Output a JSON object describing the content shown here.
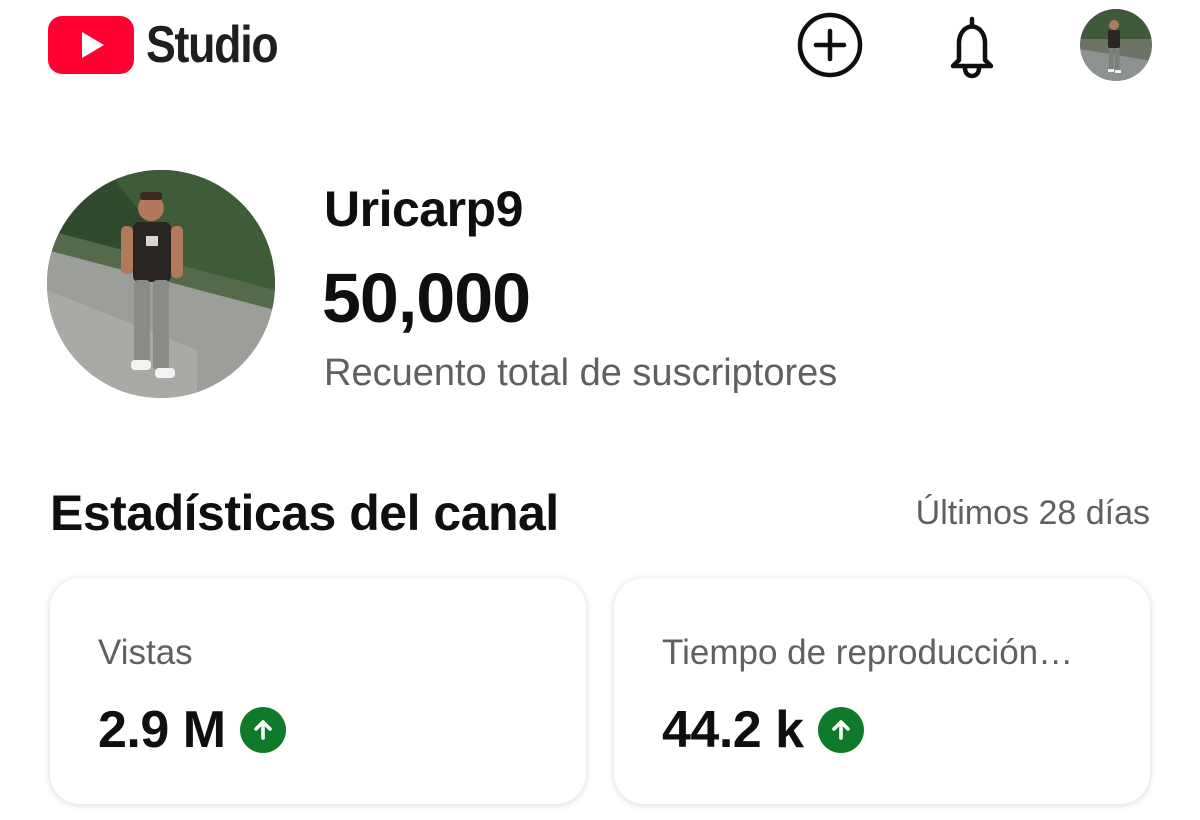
{
  "header": {
    "brand": "Studio",
    "logo_icon": "youtube-play-icon",
    "brand_color": "#ff0033",
    "actions": [
      "create-icon",
      "bell-icon",
      "account-avatar"
    ]
  },
  "channel": {
    "name": "Uricarp9",
    "subscriber_count": "50,000",
    "subscriber_label": "Recuento total de suscriptores"
  },
  "stats": {
    "title": "Estadísticas del canal",
    "period": "Últimos 28 días",
    "cards": [
      {
        "label": "Vistas",
        "value": "2.9 M",
        "trend": "up"
      },
      {
        "label": "Tiempo de reproducción…",
        "value": "44.2 k",
        "trend": "up"
      }
    ],
    "trend_color": "#0f7a2a"
  }
}
